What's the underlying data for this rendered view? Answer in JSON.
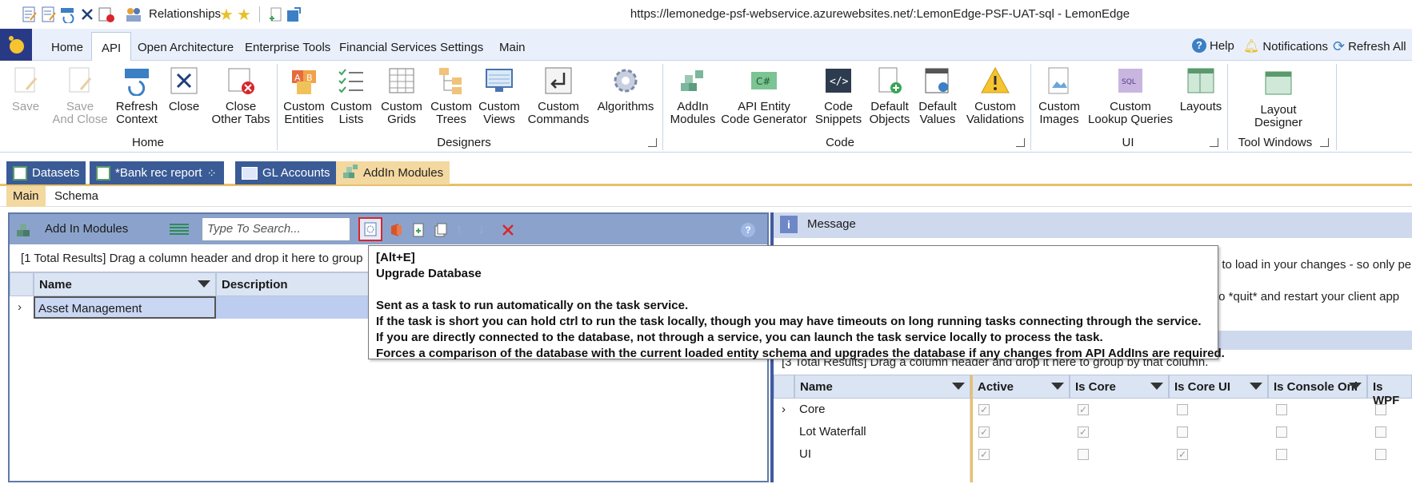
{
  "title_bar": {
    "relationships_label": "Relationships",
    "app_title": "https://lemonedge-psf-webservice.azurewebsites.net/:LemonEdge-PSF-UAT-sql - LemonEdge"
  },
  "ribbon_tabs": [
    "Home",
    "API",
    "Open Architecture",
    "Enterprise Tools",
    "Financial Services",
    "Settings",
    "Main"
  ],
  "active_tab": "API",
  "top_right": {
    "help": "Help",
    "notifications": "Notifications",
    "refresh_all": "Refresh All"
  },
  "ribbon": {
    "home": {
      "group_label": "Home",
      "save": "Save",
      "save_and_close_1": "Save",
      "save_and_close_2": "And Close",
      "refresh_context_1": "Refresh",
      "refresh_context_2": "Context",
      "close": "Close",
      "close_other_1": "Close",
      "close_other_2": "Other Tabs"
    },
    "designers": {
      "group_label": "Designers",
      "custom_entities_1": "Custom",
      "custom_entities_2": "Entities",
      "custom_lists_1": "Custom",
      "custom_lists_2": "Lists",
      "custom_grids_1": "Custom",
      "custom_grids_2": "Grids",
      "custom_trees_1": "Custom",
      "custom_trees_2": "Trees",
      "custom_views_1": "Custom",
      "custom_views_2": "Views",
      "custom_commands_1": "Custom",
      "custom_commands_2": "Commands",
      "algorithms": "Algorithms"
    },
    "code": {
      "group_label": "Code",
      "addin_modules_1": "AddIn",
      "addin_modules_2": "Modules",
      "api_entity_1": "API Entity",
      "api_entity_2": "Code Generator",
      "code_snippets_1": "Code",
      "code_snippets_2": "Snippets",
      "default_objects_1": "Default",
      "default_objects_2": "Objects",
      "default_values_1": "Default",
      "default_values_2": "Values",
      "custom_validations_1": "Custom",
      "custom_validations_2": "Validations"
    },
    "ui": {
      "group_label": "UI",
      "custom_images_1": "Custom",
      "custom_images_2": "Images",
      "custom_lookup_1": "Custom",
      "custom_lookup_2": "Lookup Queries",
      "layouts": "Layouts"
    },
    "tool_windows": {
      "group_label": "Tool Windows",
      "layout_designer_1": "Layout",
      "layout_designer_2": "Designer"
    }
  },
  "doc_tabs": [
    "Datasets",
    "*Bank rec report",
    "GL Accounts",
    "AddIn Modules"
  ],
  "sub_tabs": [
    "Main",
    "Schema"
  ],
  "left_panel": {
    "title": "Add In Modules",
    "search_placeholder": "Type To Search...",
    "group_bar": "[1 Total Results] Drag a column header and drop it here to group",
    "columns": [
      "Name",
      "Description"
    ],
    "rows": [
      {
        "name": "Asset Management",
        "description": ""
      }
    ]
  },
  "tooltip": {
    "shortcut": "[Alt+E]",
    "title": "Upgrade Database",
    "line1": "Sent as a task to run automatically on the task service.",
    "line2": "If the task is short you can hold ctrl to run the task locally, though you may have timeouts on long running tasks connecting through the service.",
    "line3": "If you are directly connected to the database, not through a service, you can launch the task service locally to process the task.",
    "line4": "Forces a comparison of the database with the current loaded entity schema and upgrades the database if any changes from API AddIns are required."
  },
  "right_panel": {
    "message_title": "Message",
    "msg_line1": "t to load in your changes - so only pe",
    "msg_line2": "to *quit* and restart your client app",
    "group_bar": "[3 Total Results] Drag a column header and drop it here to group by that column.",
    "columns": [
      "Name",
      "Active",
      "Is Core",
      "Is Core UI",
      "Is Console Onl",
      "Is WPF"
    ],
    "rows": [
      {
        "name": "Core",
        "active": true,
        "is_core": true,
        "is_core_ui": false,
        "is_console": false,
        "is_wpf": false
      },
      {
        "name": "Lot Waterfall",
        "active": true,
        "is_core": true,
        "is_core_ui": false,
        "is_console": false,
        "is_wpf": false
      },
      {
        "name": "UI",
        "active": true,
        "is_core": false,
        "is_core_ui": true,
        "is_console": false,
        "is_wpf": false
      }
    ]
  },
  "colors": {
    "accent_blue": "#3a5b96",
    "active_doc_tab": "#f3d8a0",
    "panel_header": "#8ba3cc",
    "highlight_red": "#d9252b"
  }
}
